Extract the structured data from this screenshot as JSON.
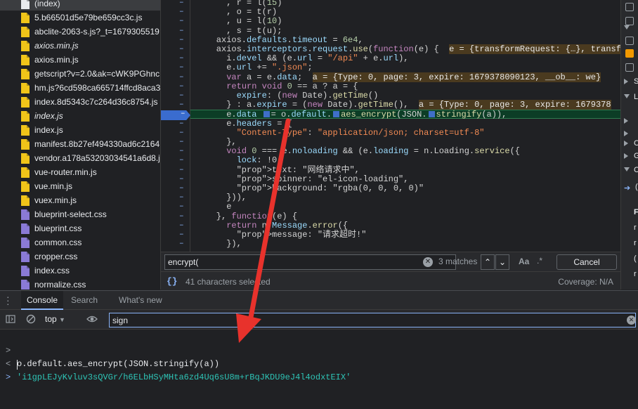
{
  "file_tree": {
    "files": [
      {
        "name": "(index)",
        "icon": "document-icon",
        "italic": false,
        "selected": true
      },
      {
        "name": "5.b66501d5e79be659cc3c.js",
        "icon": "js-file-icon",
        "italic": false
      },
      {
        "name": "abclite-2063-s.js?_t=1679305519",
        "icon": "js-file-icon",
        "italic": false
      },
      {
        "name": "axios.min.js",
        "icon": "js-file-icon",
        "italic": true
      },
      {
        "name": "axios.min.js",
        "icon": "js-file-icon",
        "italic": false
      },
      {
        "name": "getscript?v=2.0&ak=cWK9PGhnc",
        "icon": "js-file-icon",
        "italic": false
      },
      {
        "name": "hm.js?6cd598ca665714ffcd8aca3",
        "icon": "js-file-icon",
        "italic": false
      },
      {
        "name": "index.8d5343c7c264d36c8754.js",
        "icon": "js-file-icon",
        "italic": false
      },
      {
        "name": "index.js",
        "icon": "js-file-icon",
        "italic": true
      },
      {
        "name": "index.js",
        "icon": "js-file-icon",
        "italic": false
      },
      {
        "name": "manifest.8b27ef494330ad6c2164",
        "icon": "js-file-icon",
        "italic": false
      },
      {
        "name": "vendor.a178a53203034541a6d8.j",
        "icon": "js-file-icon",
        "italic": false
      },
      {
        "name": "vue-router.min.js",
        "icon": "js-file-icon",
        "italic": false
      },
      {
        "name": "vue.min.js",
        "icon": "js-file-icon",
        "italic": false
      },
      {
        "name": "vuex.min.js",
        "icon": "js-file-icon",
        "italic": false
      },
      {
        "name": "blueprint-select.css",
        "icon": "css-file-icon",
        "italic": false
      },
      {
        "name": "blueprint.css",
        "icon": "css-file-icon",
        "italic": false
      },
      {
        "name": "common.css",
        "icon": "css-file-icon",
        "italic": false
      },
      {
        "name": "cropper.css",
        "icon": "css-file-icon",
        "italic": false
      },
      {
        "name": "index.css",
        "icon": "css-file-icon",
        "italic": false
      },
      {
        "name": "normalize.css",
        "icon": "css-file-icon",
        "italic": false
      }
    ]
  },
  "code": {
    "lines": [
      ", r = l(15)",
      ", o = t(r)",
      ", u = l(10)",
      ", s = t(u);",
      "axios.defaults.timeout = 6e4,",
      "axios.interceptors.request.use(function(e) {",
      "i.devel && (e.url = \"/api\" + e.url),",
      "e.url += \".json\";",
      "var a = e.data;",
      "return void 0 == a ? a = {",
      "expire: (new Date).getTime()",
      "} : a.expire = (new Date).getTime(),",
      "e.data = o.default.aes_encrypt(JSON.stringify(a)),",
      "e.headers = {",
      "\"Content-Type\": \"application/json; charset=utf-8\"",
      "},",
      "void 0 === e.noloading && (e.loading = n.Loading.service({",
      "lock: !0,",
      "text: \"网络请求中\",",
      "spinner: \"el-icon-loading\",",
      "background: \"rgba(0, 0, 0, 0)\"",
      "})),",
      "e",
      "}, function(e) {",
      "return n.Message.error({",
      "message: \"请求超时!\"",
      "}),"
    ],
    "inline_values": {
      "interceptor_e": "e = {transformRequest: {…}, transf",
      "data_a": "a = {Type: 0, page: 3, expire: 1679378090123, __ob__: we}",
      "expire_a": "a = {Type: 0, page: 3, expire: 1679378"
    },
    "gutter_marker": "–"
  },
  "right_panel": {
    "items": [
      "S",
      "L",
      "C",
      "G",
      "C",
      "F",
      "r",
      "r",
      "(",
      "r"
    ]
  },
  "search": {
    "query": "encrypt(",
    "match_count": "3 matches",
    "prev_label": "⌃",
    "next_label": "⌄",
    "case_label": "Aa",
    "regex_label": ".*",
    "cancel_label": "Cancel"
  },
  "status": {
    "braces_label": "{}",
    "selection_text": "41 characters selected",
    "coverage": "Coverage: N/A"
  },
  "drawer": {
    "tabs": [
      "Console",
      "Search",
      "What's new"
    ],
    "active": "Console"
  },
  "console_toolbar": {
    "context": "top",
    "filter": "sign"
  },
  "console": {
    "input_line": "o.default.aes_encrypt(JSON.stringify(a))",
    "result_line": "'i1gpLEJyKvluv3sQVGr/h6ELbHSyMHta6zd4Uq6sU8m+rBqJKDU9eJ4l4odxtEIX'",
    "input_prompt": ">",
    "result_prompt": "<",
    "active_prompt": ">"
  },
  "colors": {
    "annotation_arrow": "#e8322c",
    "js_icon": "#f0c419",
    "css_icon": "#8a7ad6",
    "result_text": "#2ec4b6"
  }
}
